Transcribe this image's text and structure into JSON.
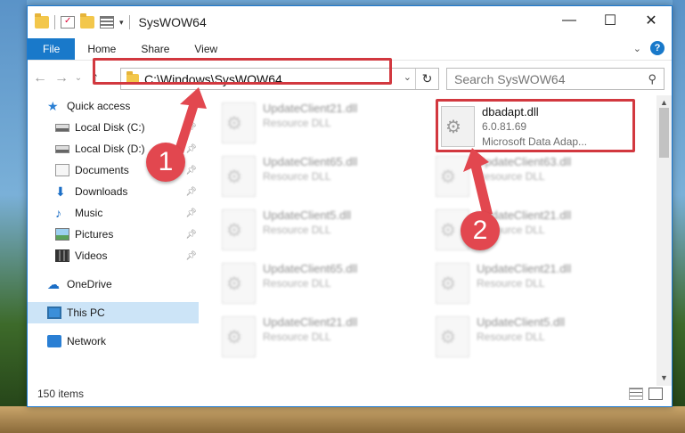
{
  "window": {
    "title": "SysWOW64",
    "controls": {
      "minimize": "—",
      "maximize": "☐",
      "close": "✕"
    }
  },
  "ribbon": {
    "tabs": [
      "File",
      "Home",
      "Share",
      "View"
    ]
  },
  "navigation": {
    "address": "C:\\Windows\\SysWOW64",
    "search_placeholder": "Search SysWOW64"
  },
  "sidebar": {
    "items": [
      {
        "label": "Quick access",
        "icon": "star-icon"
      },
      {
        "label": "Local Disk (C:)",
        "icon": "disk-icon",
        "pinned": true
      },
      {
        "label": "Local Disk (D:)",
        "icon": "disk-icon",
        "pinned": true
      },
      {
        "label": "Documents",
        "icon": "documents-icon",
        "pinned": true
      },
      {
        "label": "Downloads",
        "icon": "downloads-icon",
        "pinned": true
      },
      {
        "label": "Music",
        "icon": "music-icon",
        "pinned": true
      },
      {
        "label": "Pictures",
        "icon": "pictures-icon",
        "pinned": true
      },
      {
        "label": "Videos",
        "icon": "videos-icon",
        "pinned": true
      },
      {
        "label": "OneDrive",
        "icon": "cloud-icon"
      },
      {
        "label": "This PC",
        "icon": "pc-icon",
        "selected": true
      },
      {
        "label": "Network",
        "icon": "network-icon"
      }
    ]
  },
  "files": {
    "selected": {
      "name": "dbadapt.dll",
      "version": "6.0.81.69",
      "company": "Microsoft Data Adap..."
    },
    "blurred": [
      {
        "name": "UpdateClient21.dll",
        "type": "Resource DLL"
      },
      {
        "name": "UpdateClient65.dll",
        "type": "Resource DLL"
      },
      {
        "name": "UpdateClient63.dll",
        "type": "Resource DLL"
      },
      {
        "name": "UpdateClient5.dll",
        "type": "Resource DLL"
      },
      {
        "name": "UpdateClient21.dll",
        "type": "Resource DLL"
      },
      {
        "name": "UpdateClient65.dll",
        "type": "Resource DLL"
      },
      {
        "name": "UpdateClient21.dll",
        "type": "Resource DLL"
      },
      {
        "name": "UpdateClient21.dll",
        "type": "Resource DLL"
      },
      {
        "name": "UpdateClient5.dll",
        "type": "Resource DLL"
      }
    ]
  },
  "status": {
    "item_count": "150 items"
  },
  "annotations": {
    "step1": "1",
    "step2": "2",
    "accent": "#e2474f"
  }
}
